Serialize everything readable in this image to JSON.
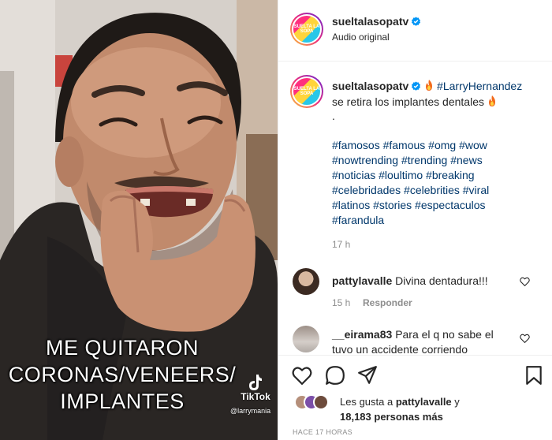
{
  "video": {
    "caption_lines": [
      "ME QUITARON",
      "CORONAS/VENEERS/",
      "IMPLANTES"
    ],
    "tiktok_label": "TikTok",
    "tiktok_handle": "@larrymania"
  },
  "header": {
    "username": "sueltalasopatv",
    "subtitle": "Audio original",
    "avatar_text": "SUELTA LA SOPA"
  },
  "post": {
    "username": "sueltalasopatv",
    "mention": "#LarryHernandez",
    "line2": "se retira los implantes dentales",
    "dot": ".",
    "hashtag_lines": [
      "#famosos #famous #omg #wow",
      "#nowtrending #trending #news",
      "#noticias #loultimo #breaking",
      "#celebridades #celebrities #viral",
      "#latinos #stories #espectaculos",
      "#farandula"
    ],
    "time": "17 h"
  },
  "comments": [
    {
      "username": "pattylavalle",
      "text": "Divina dentadura!!!",
      "time": "15 h",
      "reply_label": "Responder"
    },
    {
      "username": "__eirama83",
      "text_line1": "Para el q no sabe el",
      "text_line2": "tuvo un accidente corriendo"
    }
  ],
  "likes": {
    "prefix": "Les gusta a",
    "user": "pattylavalle",
    "connector": "y",
    "count_text": "18,183 personas más"
  },
  "timeago": "HACE 17 HORAS",
  "colors": {
    "link": "#00376b",
    "verified": "#0095f6",
    "muted": "#8e8e8e",
    "text": "#262626"
  }
}
